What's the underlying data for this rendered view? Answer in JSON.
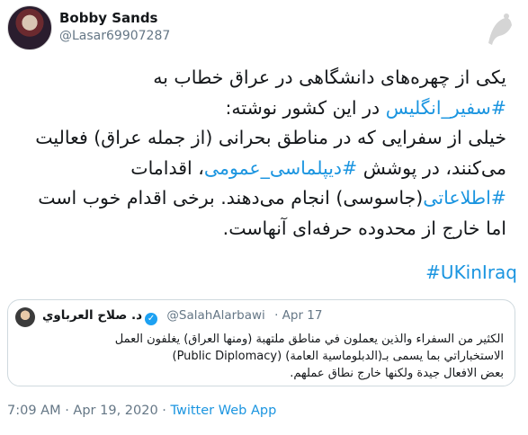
{
  "author": {
    "name": "Bobby Sands",
    "handle": "@Lasar69907287"
  },
  "tweet": {
    "l1_a": "یکی از چهره‌های دانشگاهی در عراق خطاب به",
    "l2_tag": "#سفیر_انگلیس",
    "l2_b": " در این کشور نوشته:",
    "l3": "خیلی از سفرایی که در مناطق بحرانی (از جمله عراق) فعالیت",
    "l4_a": "می‌کنند، در پوشش ",
    "l4_tag": "#دیپلماسی_عمومی",
    "l4_b": "، اقدامات",
    "l5_tag": "#اطلاعاتی",
    "l5_b": "(جاسوسی) انجام می‌دهند. برخی اقدام خوب است",
    "l6": "اما خارج از محدوده حرفه‌ای آنهاست.",
    "hashtag_ltr": "#UKinIraq"
  },
  "quote": {
    "name": "د. صلاح العرباوي",
    "handle": "@SalahAlarbawi",
    "date": "· Apr 17",
    "line1": "الكثير من السفراء والذين يعملون في مناطق ملتهبة (ومنها العراق) يغلفون العمل",
    "line2": "الاستخباراتي بما يسمى بـ(الدبلوماسية العامة) (Public Diplomacy)",
    "line3": "بعض الافعال جيدة ولكنها خارج نطاق عملهم."
  },
  "meta": {
    "time_date": "7:09 AM · Apr 19, 2020 · ",
    "source": "Twitter Web App"
  },
  "colors": {
    "link": "#1b95e0",
    "muted": "#657786"
  }
}
